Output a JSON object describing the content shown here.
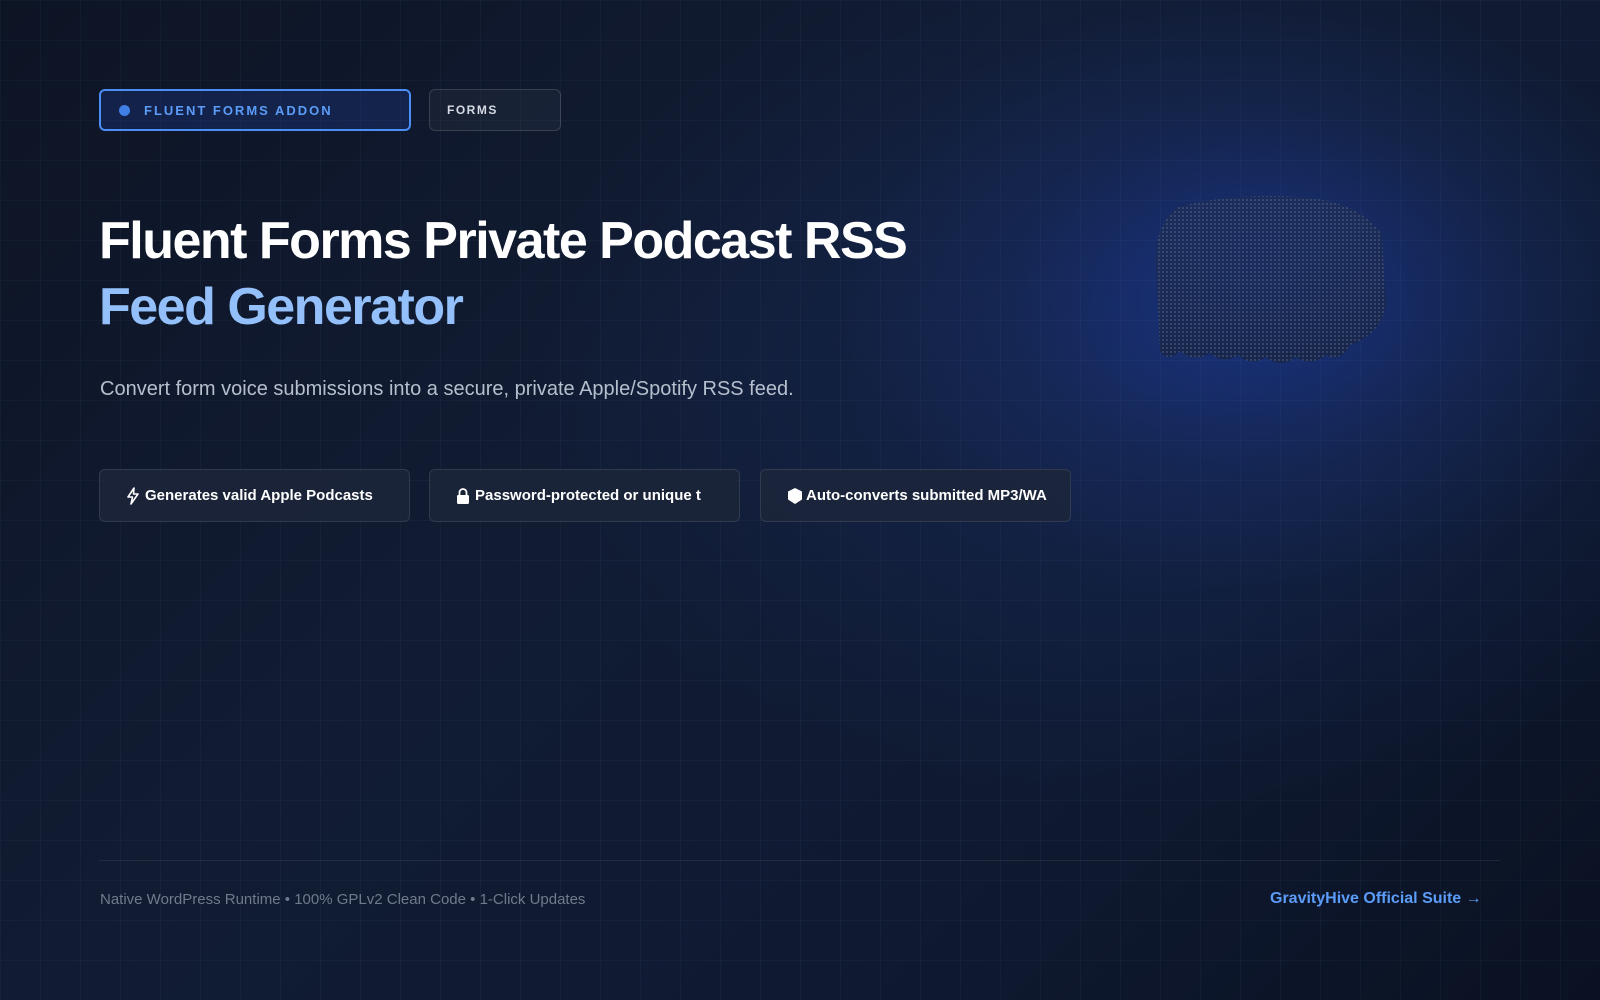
{
  "tags": {
    "addon": "FLUENT FORMS ADDON",
    "category": "FORMS"
  },
  "hero": {
    "title_line1": "Fluent Forms Private Podcast RSS",
    "title_line2": "Feed Generator",
    "subtitle": "Convert form voice submissions into a secure, private Apple/Spotify RSS feed."
  },
  "features": [
    {
      "icon": "lightning-icon",
      "label": "Generates valid Apple Podcasts"
    },
    {
      "icon": "lock-icon",
      "label": "Password-protected or unique t"
    },
    {
      "icon": "shield-icon",
      "label": "Auto-converts submitted MP3/WA"
    }
  ],
  "footer": {
    "tagline": "Native WordPress Runtime • 100% GPLv2 Clean Code • 1-Click Updates",
    "link_label": "GravityHive Official Suite →"
  },
  "colors": {
    "accent": "#5b9cf8",
    "title_highlight": "#93c0fb",
    "background": "#111c33"
  }
}
